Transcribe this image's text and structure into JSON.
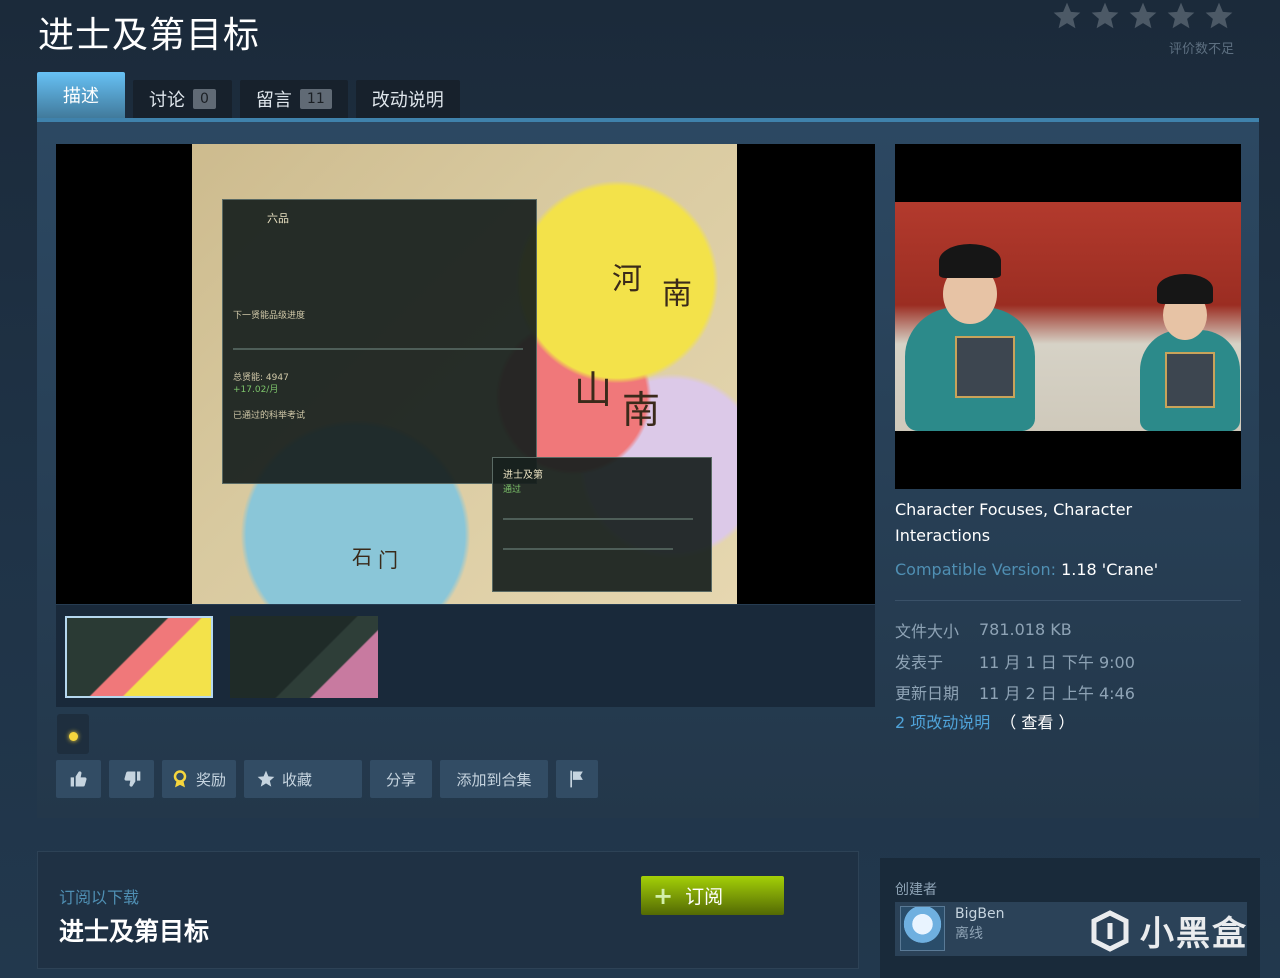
{
  "title": "进士及第目标",
  "rating": {
    "stars": 5,
    "filled": 0,
    "note": "评价数不足"
  },
  "tabs": [
    {
      "label": "描述",
      "count": null
    },
    {
      "label": "讨论",
      "count": "0"
    },
    {
      "label": "留言",
      "count": "11"
    },
    {
      "label": "改动说明",
      "count": null
    }
  ],
  "media": {
    "main_screenshot_text": {
      "panel_title": "六品",
      "next_rank": "下一贤能品级进度",
      "total": "总贤能: 4947",
      "rate": "+17.02/月",
      "exams": "已通过的科举考试",
      "popup_title": "进士及第",
      "popup_status": "通过",
      "map_labels": [
        "河",
        "南",
        "山",
        "南",
        "石",
        "门"
      ]
    },
    "thumbnails_count": 2
  },
  "actions": {
    "award_label": "奖励",
    "favorite_label": "收藏",
    "share_label": "分享",
    "add_collection_label": "添加到合集"
  },
  "sidebar": {
    "tags": "Character Focuses, Character Interactions",
    "compat_label": "Compatible Version:",
    "compat_value": "1.18 'Crane'",
    "stats": [
      {
        "key": "文件大小",
        "value": "781.018 KB"
      },
      {
        "key": "发表于",
        "value": "11 月 1 日 下午 9:00"
      },
      {
        "key": "更新日期",
        "value": "11 月 2 日 上午 4:46"
      }
    ],
    "changes_link": "2 项改动说明",
    "changes_view": "（ 查看 ）"
  },
  "subscribe": {
    "label": "订阅以下载",
    "title": "进士及第目标",
    "button": "订阅"
  },
  "creator": {
    "label": "创建者",
    "name": "BigBen",
    "status": "离线"
  },
  "watermark": "小黑盒",
  "colors": {
    "accent_blue": "#67c1f5",
    "subscribe_green": "#a4d007",
    "award_yellow": "#f6d63d"
  }
}
